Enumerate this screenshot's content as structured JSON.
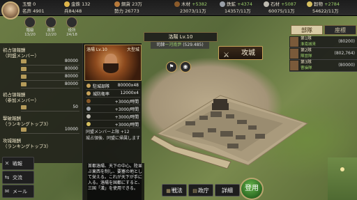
{
  "colors": {
    "accent": "#c9a45a",
    "positive": "#9ccf6a",
    "panel": "#1e1e1a"
  },
  "topbar": {
    "resources": [
      {
        "icon": "jade-icon",
        "label": "玉璧",
        "value": "0"
      },
      {
        "icon": "gold-icon",
        "label": "金銖",
        "value": "132"
      },
      {
        "icon": "copper-icon",
        "label": "銅貨",
        "value": "23万"
      },
      {
        "icon": "fame-icon",
        "label": "名声",
        "value": "4901"
      },
      {
        "icon": "army-icon",
        "label": "兵",
        "value": "84/48"
      },
      {
        "icon": "grain-icon",
        "label": "",
        "value": "26773"
      },
      {
        "icon": "wood-icon",
        "label": "木材",
        "value": "+5382"
      },
      {
        "icon": "wood-icon",
        "label": "",
        "value": "23073/11万"
      },
      {
        "icon": "iron-icon",
        "label": "鉄鉱",
        "value": "+4374"
      },
      {
        "icon": "iron-icon",
        "label": "",
        "value": "14357/11万"
      },
      {
        "icon": "stone-icon",
        "label": "石材",
        "value": "+5087"
      },
      {
        "icon": "stone-icon",
        "label": "",
        "value": "60075/11万"
      },
      {
        "icon": "grain-icon",
        "label": "穀物",
        "value": "+2784"
      },
      {
        "icon": "grain-icon",
        "label": "",
        "value": "54622/11万"
      }
    ],
    "power_label": "勢力"
  },
  "top_icons": [
    {
      "icon": "rank-icon",
      "label": "階級",
      "sub": "13/20"
    },
    {
      "icon": "government-icon",
      "label": "政策",
      "sub": "12/20"
    },
    {
      "icon": "ministry-icon",
      "label": "役所",
      "sub": "24/18"
    }
  ],
  "left_panel": {
    "sections": [
      {
        "title": "初占領報酬",
        "subtitle": "（同盟メンバー）",
        "rows": [
          "80000",
          "80000",
          "80000",
          "80000"
        ]
      },
      {
        "title": "初占領報酬",
        "subtitle": "（参加メンバー）",
        "rows": [
          "50"
        ]
      },
      {
        "title": "撃破報酬",
        "subtitle": "（ランキングトップ3）",
        "rows": [
          "10000"
        ]
      },
      {
        "title": "攻城報酬",
        "subtitle": "（ランキングトップ3）",
        "rows": []
      }
    ]
  },
  "side_menu": [
    {
      "icon": "book-icon",
      "label": "戦報"
    },
    {
      "icon": "diplomacy-icon",
      "label": "交流"
    },
    {
      "icon": "mail-icon",
      "label": "メール"
    }
  ],
  "city": {
    "name": "洛陽",
    "level": "Lv.10",
    "header": "洛陽 Lv.10",
    "owner_prefix": "司隸",
    "owner_tag": "ー河南尹",
    "coords": "(529.485)",
    "panel_title": "洛陽 Lv.10",
    "panel_type": "大型城",
    "garrison_label": "駐城部隊",
    "garrison_value": "80000x48",
    "durability_label": "城防衛率",
    "durability_value": "12000x4",
    "bonuses": [
      "+3000/時間",
      "+3000/時間",
      "+3000/時間",
      "+3000/時間"
    ],
    "alliance_note": "同盟メンバー上限 +12",
    "alliance_note2": "城占領後、同盟に帰属します",
    "description": "首都洛陽、天下の中心。陸並ぶ東西を制し、要塞の地として栄える。これが天下が手に入る。洛陽を国都にすると、三国「漢」を使用できる。",
    "attack_label": "攻城"
  },
  "right_panel": {
    "tabs": [
      "部隊",
      "座標"
    ],
    "units": [
      {
        "name": "第1隊",
        "status": "淮南城来",
        "size": "(80200)"
      },
      {
        "name": "第2隊",
        "status": "陣営隊",
        "size": "(802,764)"
      },
      {
        "name": "第3隊",
        "status": "曹操隊",
        "size": "(80000)"
      }
    ]
  },
  "bottom_bar": [
    {
      "icon": "sword-icon",
      "label": "戦法"
    },
    {
      "icon": "scroll-icon",
      "label": "政庁"
    },
    {
      "icon": "detail-icon",
      "label": "詳細"
    }
  ],
  "use_button": "登用"
}
